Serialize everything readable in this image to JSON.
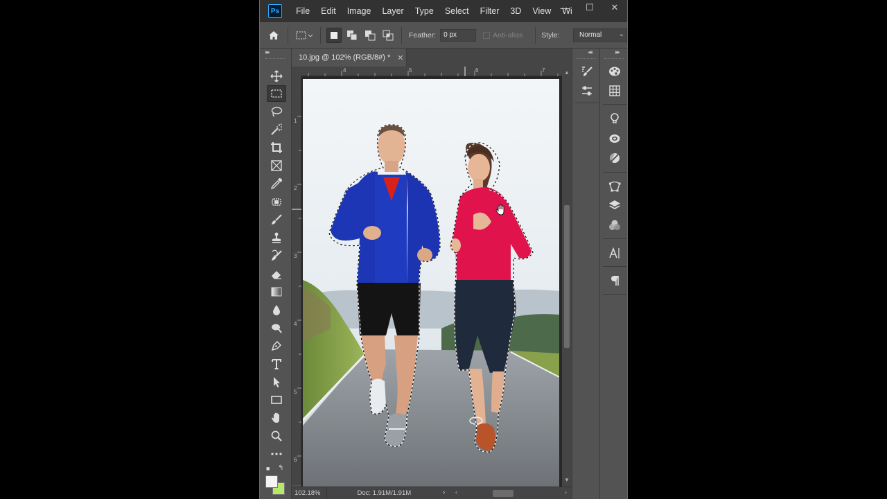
{
  "app": {
    "logo": "Ps",
    "menu": [
      "File",
      "Edit",
      "Image",
      "Layer",
      "Type",
      "Select",
      "Filter",
      "3D",
      "View",
      "Wi"
    ],
    "window_controls": [
      "minimize-icon",
      "maximize-icon",
      "close-icon"
    ]
  },
  "options_bar": {
    "feather_label": "Feather:",
    "feather_value": "0 px",
    "antialias_label": "Anti-alias",
    "style_label": "Style:",
    "style_value": "Normal",
    "selection_modes": [
      "new-selection-icon",
      "add-to-selection-icon",
      "subtract-from-selection-icon",
      "intersect-selection-icon"
    ],
    "active_mode": "new-selection-icon"
  },
  "toolbar": {
    "active_tool": "rectangular-marquee-tool",
    "tools": [
      "move-tool",
      "rectangular-marquee-tool",
      "lasso-tool",
      "magic-wand-tool",
      "crop-tool",
      "frame-tool",
      "eyedropper-tool",
      "healing-brush-tool",
      "brush-tool",
      "clone-stamp-tool",
      "history-brush-tool",
      "eraser-tool",
      "gradient-tool",
      "blur-tool",
      "dodge-tool",
      "pen-tool",
      "type-tool",
      "path-selection-tool",
      "rectangle-tool",
      "hand-tool",
      "zoom-tool",
      "edit-toolbar"
    ],
    "foreground_color": "#f4f4f4",
    "background_color": "#b8e86a"
  },
  "document": {
    "tab_title": "10.jpg @ 102% (RGB/8#) *",
    "ruler_h": [
      "4",
      "5",
      "6",
      "7"
    ],
    "ruler_v": [
      "1",
      "2",
      "3",
      "4",
      "5",
      "6"
    ]
  },
  "status": {
    "zoom": "102.18%",
    "doc": "Doc: 1.91M/1.91M"
  },
  "panels": {
    "col1": [
      "brush-settings-icon",
      "properties-adjust-icon"
    ],
    "col2": [
      "color-palette-icon",
      "swatches-grid-icon",
      "learn-lightbulb-icon",
      "libraries-icon",
      "adjustments-icon",
      "paths-icon",
      "layers-icon",
      "channels-icon",
      "character-icon",
      "paragraph-icon"
    ]
  }
}
